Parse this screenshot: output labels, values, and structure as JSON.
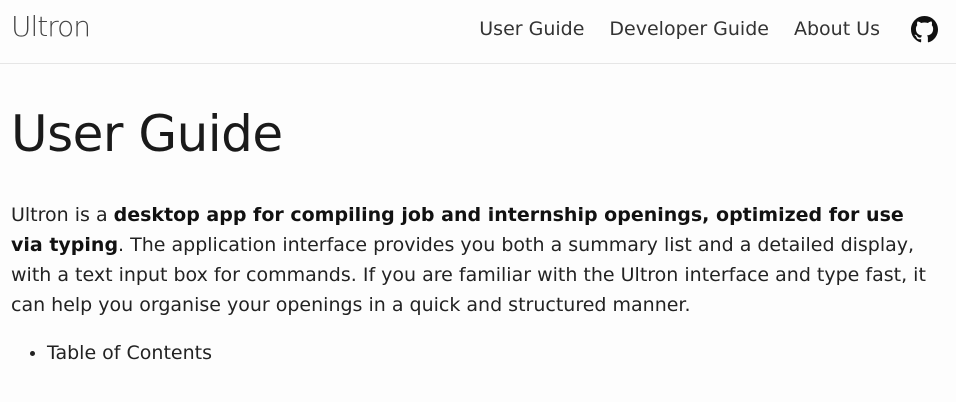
{
  "navbar": {
    "brand": "Ultron",
    "links": [
      {
        "label": "User Guide"
      },
      {
        "label": "Developer Guide"
      },
      {
        "label": "About Us"
      }
    ],
    "github_icon": "github-icon"
  },
  "main": {
    "title": "User Guide",
    "intro": {
      "prefix": "Ultron is a ",
      "bold": "desktop app for compiling job and internship openings, optimized for use via typing",
      "suffix": ". The application interface provides you both a summary list and a detailed display, with a text input box for commands. If you are familiar with the Ultron interface and type fast, it can help you organise your openings in a quick and structured manner."
    },
    "toc": [
      {
        "label": "Table of Contents"
      }
    ]
  }
}
